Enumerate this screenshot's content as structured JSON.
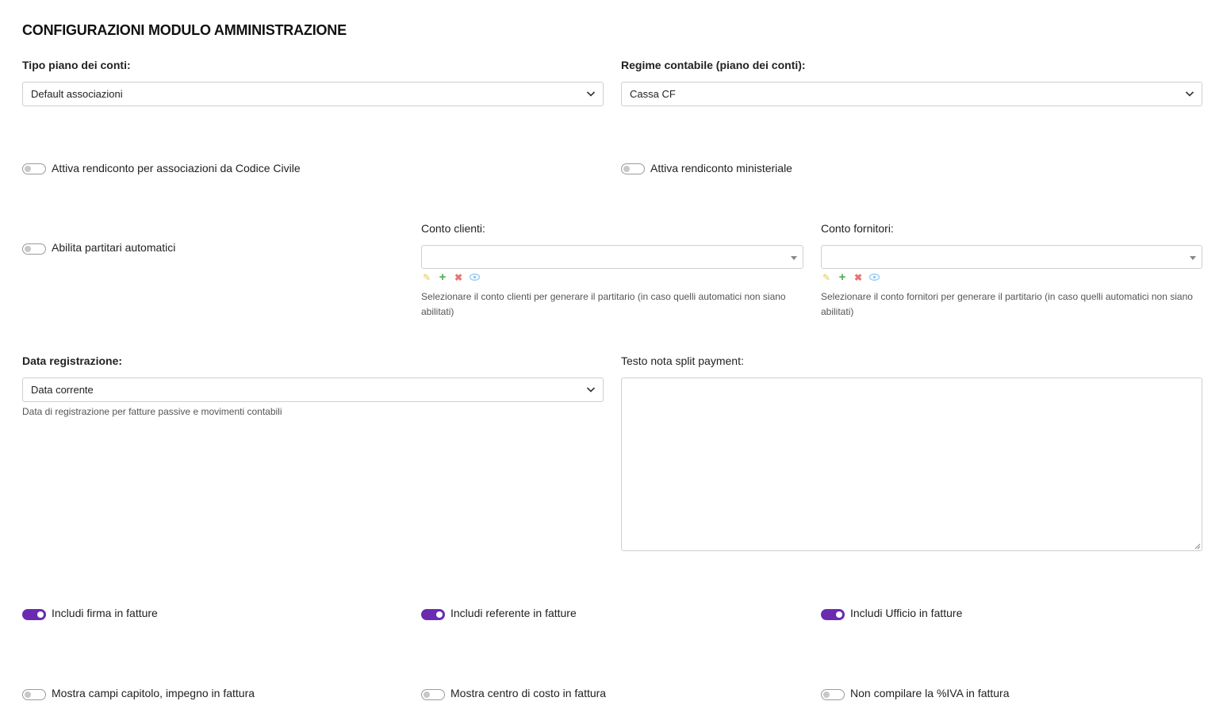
{
  "title": "CONFIGURAZIONI MODULO AMMINISTRAZIONE",
  "tipo_piano": {
    "label": "Tipo piano dei conti:",
    "value": "Default associazioni"
  },
  "regime": {
    "label": "Regime contabile (piano dei conti):",
    "value": "Cassa CF"
  },
  "toggles_row1": [
    {
      "label": "Attiva rendiconto per associazioni da Codice Civile",
      "on": false
    },
    {
      "label": "Attiva rendiconto ministeriale",
      "on": false
    }
  ],
  "partitari": {
    "label": "Abilita partitari automatici",
    "on": false
  },
  "conto_clienti": {
    "label": "Conto clienti:",
    "value": "",
    "help": "Selezionare il conto clienti per generare il partitario (in caso quelli automatici non siano abilitati)"
  },
  "conto_fornitori": {
    "label": "Conto fornitori:",
    "value": "",
    "help": "Selezionare il conto fornitori per generare il partitario (in caso quelli automatici non siano abilitati)"
  },
  "data_registrazione": {
    "label": "Data registrazione:",
    "value": "Data corrente",
    "help": "Data di registrazione per fatture passive e movimenti contabili"
  },
  "split_payment": {
    "label": "Testo nota split payment:",
    "value": ""
  },
  "toggles_row3": [
    {
      "label": "Includi firma in fatture",
      "on": true
    },
    {
      "label": "Includi referente in fatture",
      "on": true
    },
    {
      "label": "Includi Ufficio in fatture",
      "on": true
    }
  ],
  "toggles_row4": [
    {
      "label": "Mostra campi capitolo, impegno in fattura",
      "on": false
    },
    {
      "label": "Mostra centro di costo in fattura",
      "on": false
    },
    {
      "label": "Non compilare la %IVA in fattura",
      "on": false
    }
  ],
  "colors": {
    "accent": "#6b2bb0",
    "border": "#cfcfcf",
    "pencil": "#e8c84a",
    "plus": "#4caf50",
    "delete": "#e57373",
    "view": "#90caf9"
  },
  "icons": [
    "pencil-icon",
    "plus-icon",
    "delete-icon",
    "eye-icon",
    "chevron-down-icon",
    "caret-down-icon"
  ]
}
